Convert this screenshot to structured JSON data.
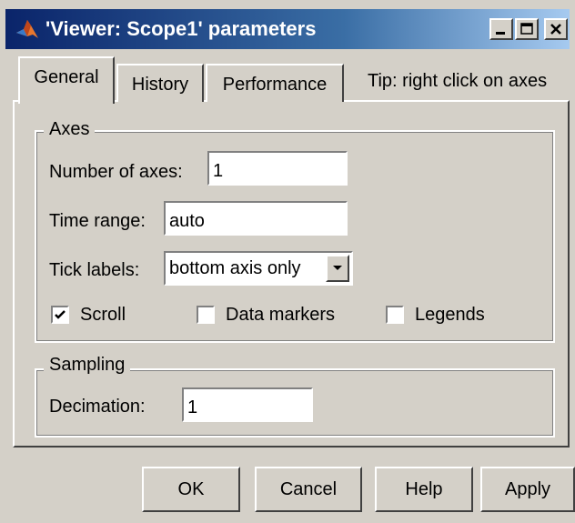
{
  "window": {
    "title": "'Viewer: Scope1' parameters",
    "icon": "matlab-logo-icon"
  },
  "tabs": [
    {
      "label": "General",
      "selected": true
    },
    {
      "label": "History",
      "selected": false
    },
    {
      "label": "Performance",
      "selected": false
    }
  ],
  "tip": "Tip: right click on axes",
  "axes": {
    "group_label": "Axes",
    "num_axes_label": "Number of axes:",
    "num_axes_value": "1",
    "time_range_label": "Time range:",
    "time_range_value": "auto",
    "tick_labels_label": "Tick labels:",
    "tick_labels_value": "bottom axis only",
    "scroll_label": "Scroll",
    "scroll_checked": true,
    "data_markers_label": "Data markers",
    "data_markers_checked": false,
    "legends_label": "Legends",
    "legends_checked": false
  },
  "sampling": {
    "group_label": "Sampling",
    "decimation_label": "Decimation:",
    "decimation_value": "1"
  },
  "buttons": {
    "ok": "OK",
    "cancel": "Cancel",
    "help": "Help",
    "apply": "Apply"
  },
  "colors": {
    "dialog_bg": "#d4d0c8",
    "title_start": "#0a246a",
    "title_end": "#a6caf0"
  }
}
